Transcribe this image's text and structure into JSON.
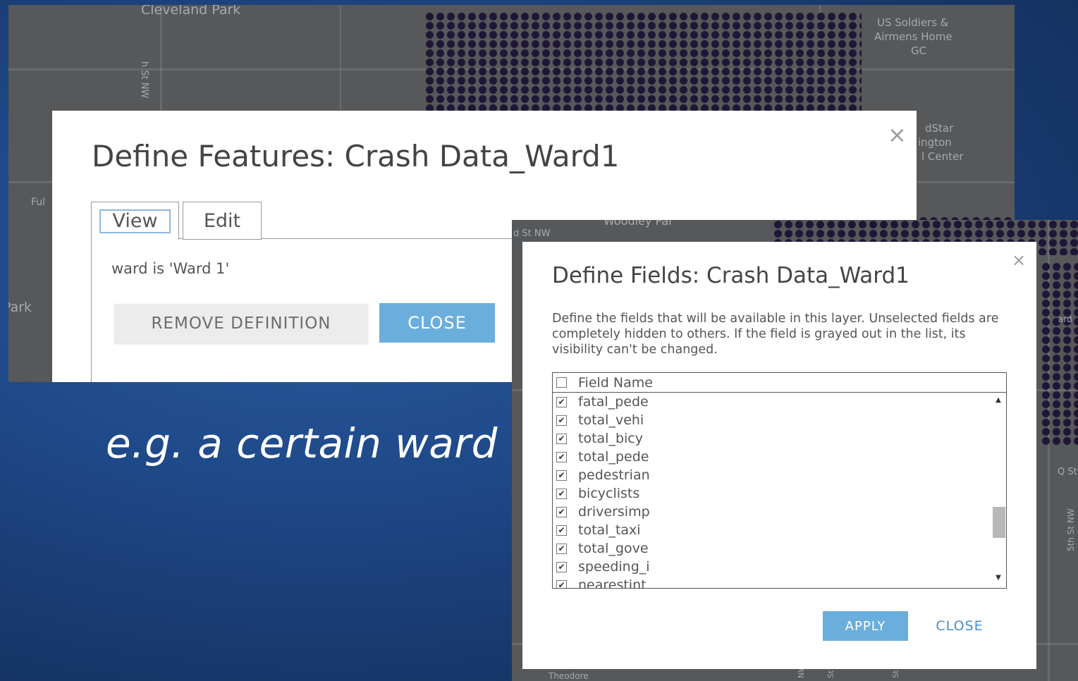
{
  "background_color": "#1f4a8a",
  "caption": "e.g. a certain ward",
  "map_top": {
    "labels": {
      "neighborhood": "Cleveland Park",
      "soldiers_home": "US Soldiers &",
      "soldiers_home_2": "Airmens Home",
      "soldiers_home_3": "GC",
      "street_v": "h St NW",
      "medstar_1": "dStar",
      "medstar_2": "ington",
      "medstar_3": "l Center",
      "edge_left": "Ful",
      "park": "Park"
    }
  },
  "map_right": {
    "labels": {
      "woodley": "Woodley Par",
      "d_st": "d St NW",
      "ward": "ard",
      "q_st": "Q St",
      "fifth_st": "5th St NW",
      "theodore": "Theodore",
      "nw_1": "NW",
      "st_1": "St",
      "st_2": "St"
    }
  },
  "features_dialog": {
    "title": "Define Features: Crash Data_Ward1",
    "close_icon": "×",
    "tabs": [
      {
        "label": "View",
        "active": true
      },
      {
        "label": "Edit",
        "active": false
      }
    ],
    "expression": "ward is 'Ward 1'",
    "remove_button": "REMOVE DEFINITION",
    "close_button": "CLOSE",
    "accent": "#6aaedc"
  },
  "fields_dialog": {
    "title": "Define Fields: Crash Data_Ward1",
    "close_icon": "×",
    "description": "Define the fields that will be available in this layer. Unselected fields are completely hidden to others. If the field is grayed out in the list, its visibility can't be changed.",
    "header_label": "Field Name",
    "header_checked": false,
    "fields": [
      {
        "name": "fatal_pede",
        "checked": true
      },
      {
        "name": "total_vehi",
        "checked": true
      },
      {
        "name": "total_bicy",
        "checked": true
      },
      {
        "name": "total_pede",
        "checked": true
      },
      {
        "name": "pedestrian",
        "checked": true
      },
      {
        "name": "bicyclists",
        "checked": true
      },
      {
        "name": "driversimp",
        "checked": true
      },
      {
        "name": "total_taxi",
        "checked": true
      },
      {
        "name": "total_gove",
        "checked": true
      },
      {
        "name": "speeding_i",
        "checked": true
      },
      {
        "name": "nearestint",
        "checked": true
      }
    ],
    "apply_button": "APPLY",
    "close_button": "CLOSE",
    "accent": "#6aaedc"
  }
}
